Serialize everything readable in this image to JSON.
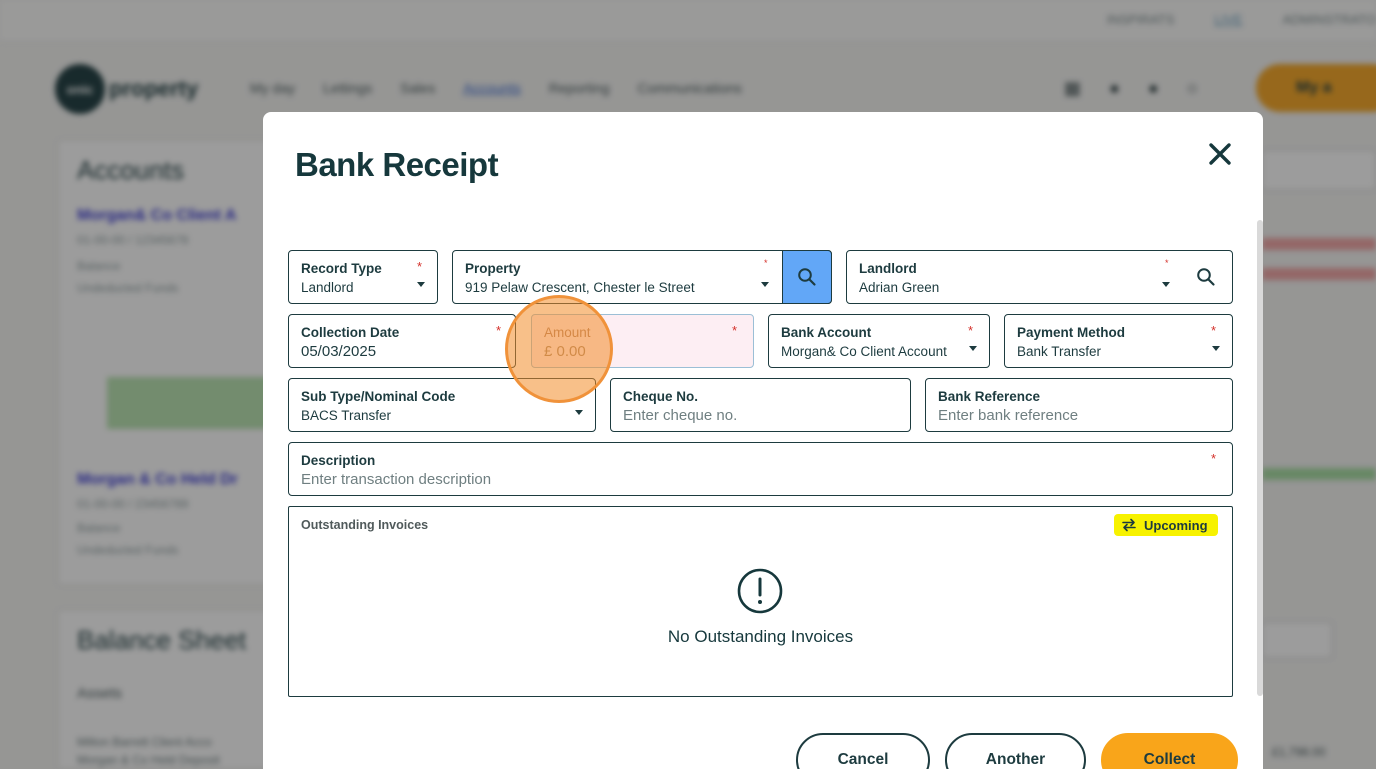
{
  "background": {
    "top_links": [
      "INSPIRATS",
      "LIVE",
      "ADMINSTRATO"
    ],
    "logo_mark": "onic",
    "logo_text": "property",
    "menu": [
      "My day",
      "Lettings",
      "Sales",
      "Accounts",
      "Reporting",
      "Communications"
    ],
    "user_label": "My a",
    "panel_title": "Accounts",
    "panel_links": [
      "Morgan& Co Client A",
      "Morgan & Co Held Dr"
    ],
    "panel_small": [
      "01-00-00 / 12345678",
      "Balance",
      "Undeducted Funds",
      "01-00-00 / 23456789",
      "Balance",
      "Undeducted Funds"
    ],
    "panel2_title": "Balance Sheet",
    "panel2_sub": "Assets",
    "panel2_rows": [
      "Milton Barrett Client Acco",
      "Morgan & Co Held Deposit"
    ],
    "right_text": "£1,798.00"
  },
  "modal": {
    "title": "Bank Receipt",
    "fields": {
      "record_type": {
        "label": "Record Type",
        "value": "Landlord"
      },
      "property": {
        "label": "Property",
        "value": "919 Pelaw Crescent, Chester le Street"
      },
      "landlord": {
        "label": "Landlord",
        "value": "Adrian Green"
      },
      "collection_date": {
        "label": "Collection Date",
        "value": "05/03/2025"
      },
      "amount": {
        "label": "Amount",
        "value": "£ 0.00"
      },
      "bank_account": {
        "label": "Bank Account",
        "value": "Morgan& Co Client Account"
      },
      "payment_method": {
        "label": "Payment Method",
        "value": "Bank Transfer"
      },
      "sub_type": {
        "label": "Sub Type/Nominal Code",
        "value": "BACS Transfer"
      },
      "cheque_no": {
        "label": "Cheque No.",
        "placeholder": "Enter cheque no."
      },
      "bank_reference": {
        "label": "Bank Reference",
        "placeholder": "Enter bank reference"
      },
      "description": {
        "label": "Description",
        "placeholder": "Enter transaction description"
      }
    },
    "required_mark": "*",
    "outstanding_invoices": {
      "title": "Outstanding Invoices",
      "toggle_label": "Upcoming",
      "empty_message": "No Outstanding Invoices"
    },
    "buttons": {
      "cancel": "Cancel",
      "another": "Another",
      "collect": "Collect"
    }
  },
  "colors": {
    "brand_dark": "#1d3b3f",
    "accent_orange": "#f9a51a",
    "search_blue": "#62a7f7",
    "required_red": "#d4302a",
    "upcoming_yellow": "#f7f200"
  }
}
